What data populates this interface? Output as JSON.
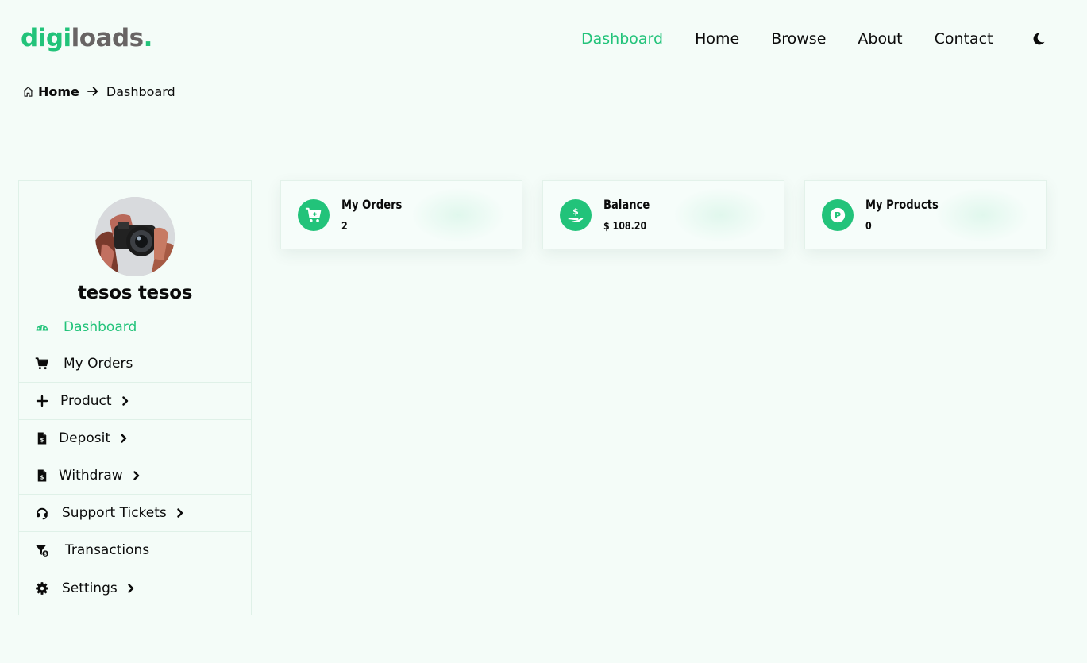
{
  "brand": {
    "logo_green": "digi",
    "logo_gray": "loads",
    "logo_dot": ".",
    "accent": "#22c37a"
  },
  "nav": {
    "items": [
      {
        "label": "Dashboard",
        "active": true
      },
      {
        "label": "Home"
      },
      {
        "label": "Browse"
      },
      {
        "label": "About"
      },
      {
        "label": "Contact"
      }
    ],
    "theme_toggle_icon": "moon-icon"
  },
  "breadcrumb": {
    "home": "Home",
    "current": "Dashboard"
  },
  "profile": {
    "name": "tesos tesos"
  },
  "sidebar": {
    "items": [
      {
        "label": "Dashboard",
        "icon": "dashboard-gauge-icon",
        "active": true
      },
      {
        "label": "My Orders",
        "icon": "cart-icon"
      },
      {
        "label": "Product",
        "icon": "plus-icon",
        "has_submenu": true
      },
      {
        "label": "Deposit",
        "icon": "invoice-dollar-icon",
        "has_submenu": true
      },
      {
        "label": "Withdraw",
        "icon": "invoice-dollar-icon",
        "has_submenu": true
      },
      {
        "label": "Support Tickets",
        "icon": "headset-icon",
        "has_submenu": true
      },
      {
        "label": "Transactions",
        "icon": "funnel-dollar-icon"
      },
      {
        "label": "Settings",
        "icon": "gear-icon",
        "has_submenu": true
      }
    ]
  },
  "cards": [
    {
      "title": "My Orders",
      "value": "2",
      "icon": "cart-plus-icon"
    },
    {
      "title": "Balance",
      "value": "$ 108.20",
      "icon": "hand-dollar-icon"
    },
    {
      "title": "My Products",
      "value": "0",
      "icon": "product-p-icon"
    }
  ]
}
